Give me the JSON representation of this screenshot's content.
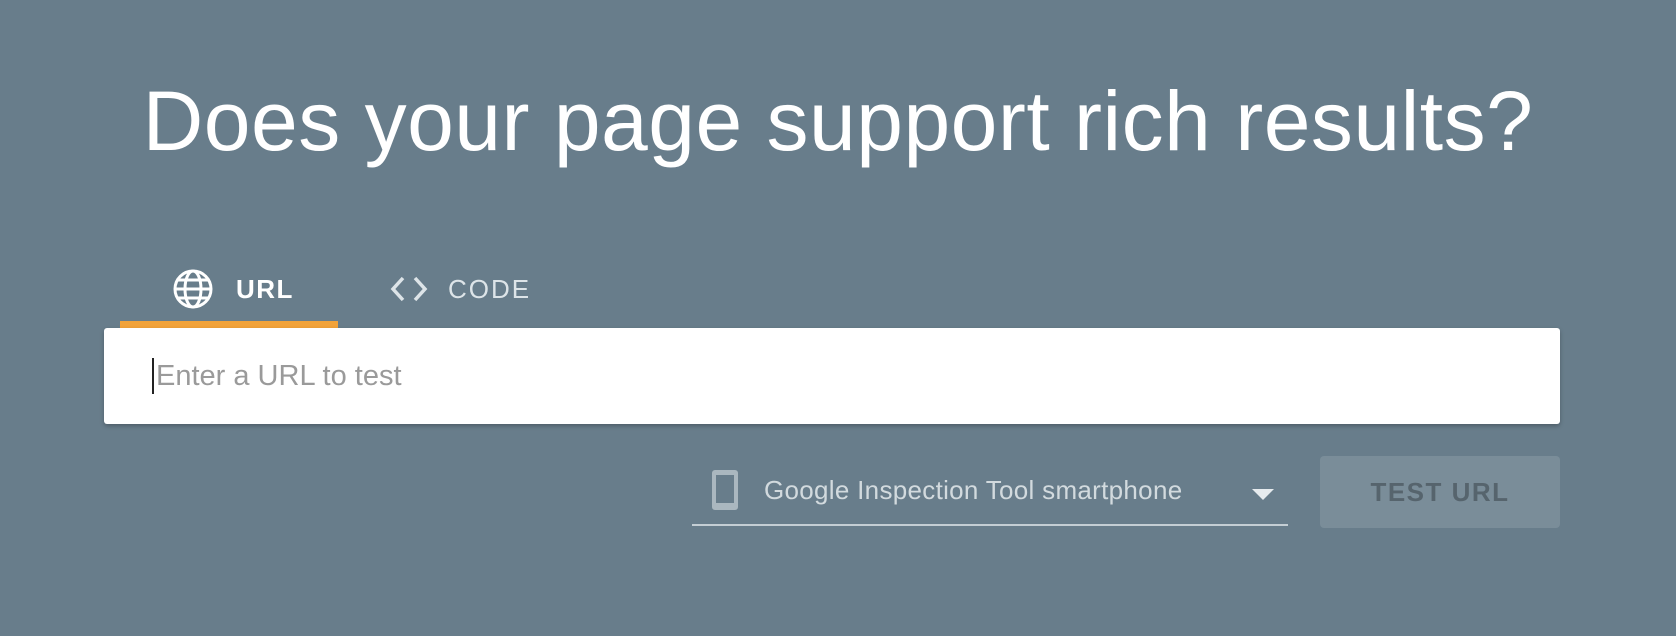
{
  "header": {
    "title": "Does your page support rich results?"
  },
  "tabs": [
    {
      "label": "URL",
      "icon": "globe-icon",
      "selected": true
    },
    {
      "label": "CODE",
      "icon": "code-icon",
      "selected": false
    }
  ],
  "url_input": {
    "value": "",
    "placeholder": "Enter a URL to test"
  },
  "user_agent": {
    "selected": "Google Inspection Tool smartphone",
    "icon": "smartphone-icon"
  },
  "actions": {
    "test_label": "TEST URL"
  },
  "colors": {
    "background": "#687d8b",
    "tab_indicator": "#f2a33a",
    "button_disabled": "#7a8d99"
  }
}
